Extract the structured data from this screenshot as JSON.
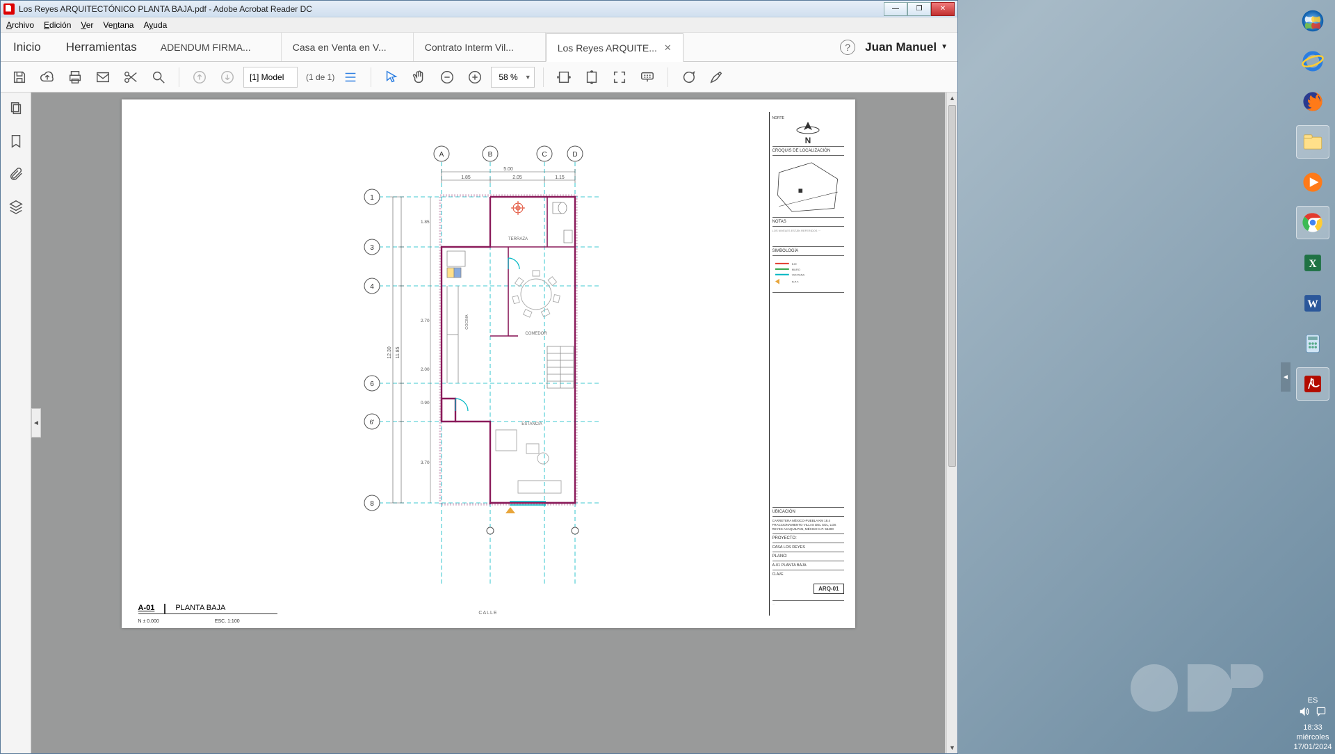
{
  "window": {
    "title": "Los Reyes ARQUITECTÓNICO PLANTA BAJA.pdf - Adobe Acrobat Reader DC"
  },
  "menubar": {
    "items": [
      "Archivo",
      "Edición",
      "Ver",
      "Ventana",
      "Ayuda"
    ]
  },
  "home_row": {
    "inicio": "Inicio",
    "herramientas": "Herramientas",
    "tabs": [
      {
        "label": "ADENDUM FIRMA..."
      },
      {
        "label": "Casa en Venta en V..."
      },
      {
        "label": "Contrato Interm Vil..."
      },
      {
        "label": "Los Reyes ARQUITE...",
        "active": true
      }
    ],
    "user": "Juan Manuel"
  },
  "toolbar": {
    "page_field": "[1] Model",
    "page_count": "(1 de 1)",
    "zoom": "58 %"
  },
  "sheet": {
    "index": "A-01",
    "name": "PLANTA BAJA",
    "level": "N ± 0.000",
    "scale": "ESC.  1:100",
    "calle": "CALLE",
    "sheet_code": "ARQ-01",
    "north": "N",
    "north_label": "NORTE",
    "loc_label": "CROQUIS DE LOCALIZACIÓN",
    "notas": "NOTAS",
    "simbologia": "SIMBOLOGÍA",
    "ubicacion": "UBICACIÓN",
    "ubicacion_text": "CARRETERA MÉXICO-PUEBLA  KM 18.4  FRACCIONAMIENTO VILLAS DEL SOL,  LOS REYES ACAQUILPAN,  MÉXICO  C.P. 56400",
    "proyecto": "PROYECTO:",
    "proyecto_text": "CASA LOS REYES",
    "plano": "PLANO:",
    "plano_text": "A-01  PLANTA BAJA",
    "clave": "CLAVE",
    "rooms": {
      "terraza": "TERRAZA",
      "cocina": "COCINA",
      "comedor": "COMEDOR",
      "estancia": "ESTANCIA"
    },
    "grid_letters": [
      "A",
      "B",
      "C",
      "D"
    ],
    "grid_numbers": [
      "1",
      "3",
      "4",
      "6",
      "6'",
      "8"
    ],
    "dims": {
      "total_w": "5.00",
      "a_b": "1.85",
      "b_c": "2.05",
      "c_d": "1.15",
      "total_h_out": "12.30",
      "total_h_in": "11.85",
      "h1": "1.85",
      "h2": "2.70",
      "h3": "2.00",
      "h4": "0.90",
      "h5": "3.70"
    }
  },
  "tray": {
    "lang": "ES",
    "time": "18:33",
    "day": "miércoles",
    "date": "17/01/2024"
  }
}
